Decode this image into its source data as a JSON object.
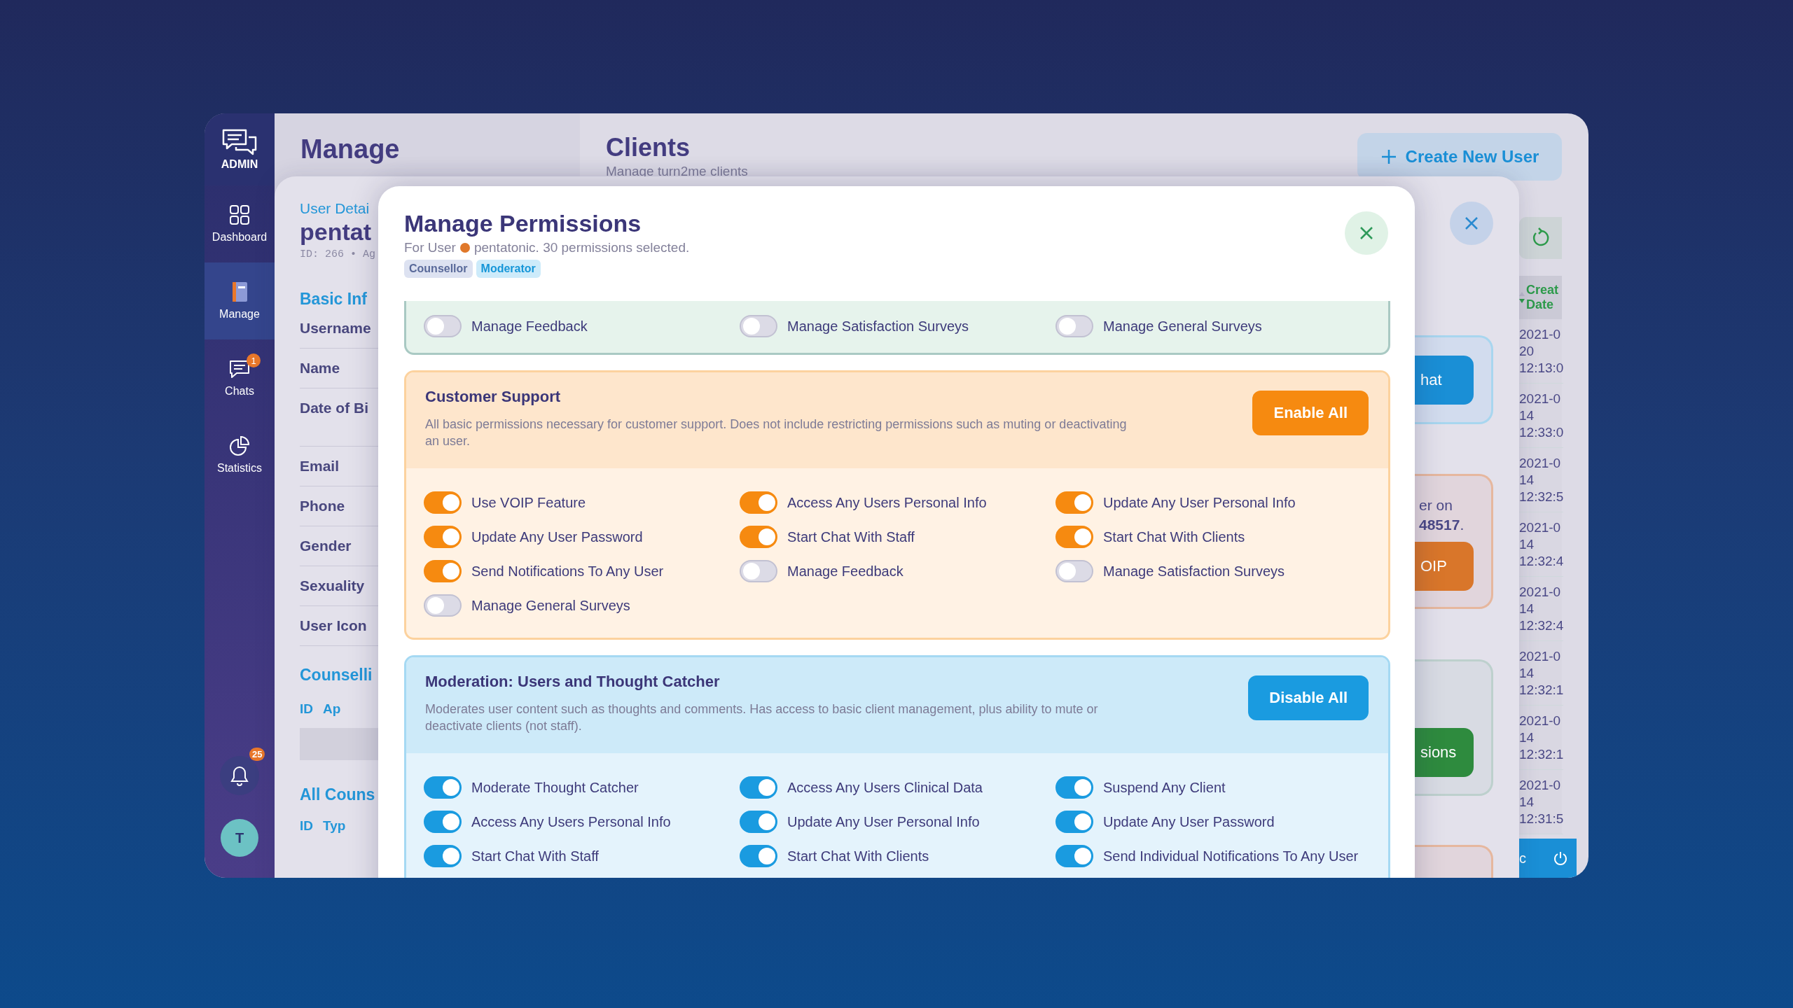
{
  "sidebar": {
    "logo_label": "ADMIN",
    "items": [
      {
        "label": "Dashboard",
        "selected": false
      },
      {
        "label": "Manage",
        "selected": true
      },
      {
        "label": "Chats",
        "selected": false,
        "badge": "1"
      },
      {
        "label": "Statistics",
        "selected": false
      }
    ],
    "notifications_count": "25",
    "avatar": "T"
  },
  "manage_column": {
    "title": "Manage"
  },
  "clients": {
    "title": "Clients",
    "subtitle": "Manage turn2me clients",
    "create_button": "Create New User",
    "table": {
      "column_header": "Creat Date",
      "rows": [
        "2021-0 20 12:13:0",
        "2021-0 14 12:33:0",
        "2021-0 14 12:32:5",
        "2021-0 14 12:32:4",
        "2021-0 14 12:32:4",
        "2021-0 14 12:32:1",
        "2021-0 14 12:32:1",
        "2021-0 14 12:31:5"
      ]
    },
    "bottom_bar": "c"
  },
  "user_details": {
    "heading": "User Detai",
    "username": "pentat",
    "meta": "ID: 266 • Ag",
    "basic_heading": "Basic Inf",
    "fields": [
      "Username",
      "Name",
      "Date of Bi",
      "Email",
      "Phone",
      "Gender",
      "Sexuality",
      "User Icon"
    ],
    "counselling_heading": "Counselli",
    "counselling_columns": [
      "ID",
      "Ap"
    ],
    "all_heading": "All Couns",
    "all_columns": [
      "ID",
      "Typ"
    ],
    "chat_button": "hat",
    "voip_text": "er on",
    "voip_number": "**48517**.",
    "voip_button": "OIP",
    "permissions_button": "sions"
  },
  "modal": {
    "title": "Manage Permissions",
    "subtitle_prefix": "For User",
    "subtitle_rest": "pentatonic. 30 permissions selected.",
    "tags": [
      {
        "label": "Counsellor",
        "color": "#dde2f1"
      },
      {
        "label": "Moderator",
        "color": "#cdebfa"
      }
    ],
    "sections": [
      {
        "kind": "green",
        "toggles": [
          {
            "label": "Manage Feedback",
            "on": false
          },
          {
            "label": "Manage Satisfaction Surveys",
            "on": false
          },
          {
            "label": "Manage General Surveys",
            "on": false
          }
        ]
      },
      {
        "kind": "orange",
        "title": "Customer Support",
        "description": "All basic permissions necessary for customer support. Does not include restricting permissions such as muting or deactivating an user.",
        "button": "Enable All",
        "toggles": [
          {
            "label": "Use VOIP Feature",
            "on": true
          },
          {
            "label": "Access Any Users Personal Info",
            "on": true
          },
          {
            "label": "Update Any User Personal Info",
            "on": true
          },
          {
            "label": "Update Any User Password",
            "on": true
          },
          {
            "label": "Start Chat With Staff",
            "on": true
          },
          {
            "label": "Start Chat With Clients",
            "on": true
          },
          {
            "label": "Send Notifications To Any User",
            "on": true
          },
          {
            "label": "Manage Feedback",
            "on": false
          },
          {
            "label": "Manage Satisfaction Surveys",
            "on": false
          },
          {
            "label": "Manage General Surveys",
            "on": false
          }
        ]
      },
      {
        "kind": "blue",
        "title": "Moderation: Users and Thought Catcher",
        "description": "Moderates user content such as thoughts and comments. Has access to basic client management, plus ability to mute or deactivate clients (not staff).",
        "button": "Disable All",
        "toggles": [
          {
            "label": "Moderate Thought Catcher",
            "on": true
          },
          {
            "label": "Access Any Users Clinical Data",
            "on": true
          },
          {
            "label": "Suspend Any Client",
            "on": true
          },
          {
            "label": "Access Any Users Personal Info",
            "on": true
          },
          {
            "label": "Update Any User Personal Info",
            "on": true
          },
          {
            "label": "Update Any User Password",
            "on": true
          },
          {
            "label": "Start Chat With Staff",
            "on": true
          },
          {
            "label": "Start Chat With Clients",
            "on": true
          },
          {
            "label": "Send Individual Notifications To Any User",
            "on": true
          }
        ]
      }
    ]
  }
}
